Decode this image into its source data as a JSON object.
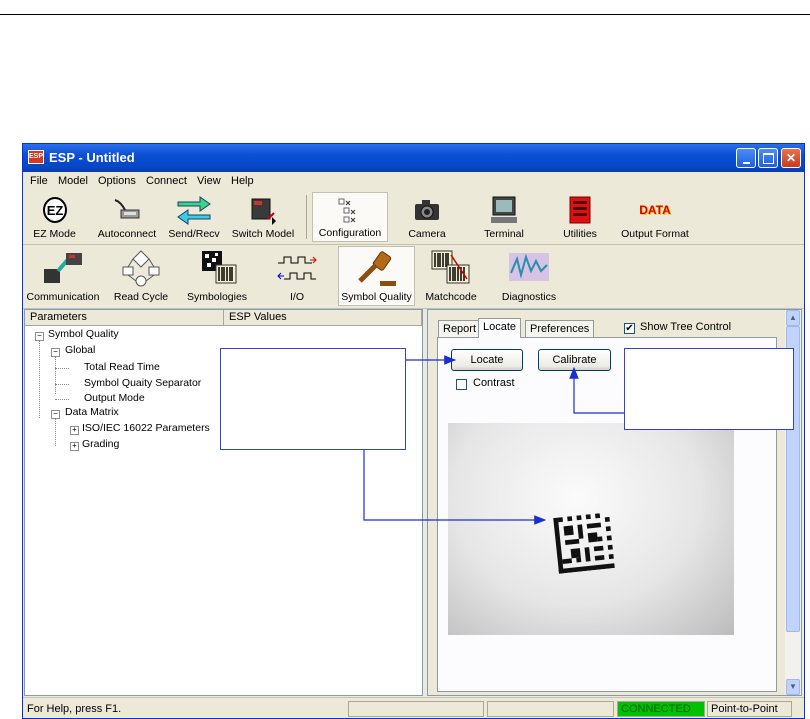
{
  "window": {
    "title": "ESP - Untitled",
    "app_icon_text": "ESP"
  },
  "menu": [
    "File",
    "Model",
    "Options",
    "Connect",
    "View",
    "Help"
  ],
  "toolbar1": [
    {
      "label": "EZ Mode",
      "icon": "ez-mode-icon"
    },
    {
      "label": "Autoconnect",
      "icon": "cable-icon"
    },
    {
      "label": "Send/Recv",
      "icon": "send-recv-icon"
    },
    {
      "label": "Switch Model",
      "icon": "switch-model-icon"
    },
    {
      "label": "Configuration",
      "icon": "configuration-icon",
      "selected": true
    },
    {
      "label": "Camera",
      "icon": "camera-icon"
    },
    {
      "label": "Terminal",
      "icon": "terminal-icon"
    },
    {
      "label": "Utilities",
      "icon": "utilities-icon"
    },
    {
      "label": "Output Format",
      "icon": "data-icon",
      "icon_text": "DATA"
    }
  ],
  "toolbar2": [
    {
      "label": "Communication",
      "icon": "communication-icon"
    },
    {
      "label": "Read Cycle",
      "icon": "read-cycle-icon"
    },
    {
      "label": "Symbologies",
      "icon": "symbologies-icon"
    },
    {
      "label": "I/O",
      "icon": "io-icon"
    },
    {
      "label": "Symbol Quality",
      "icon": "gavel-icon",
      "selected": true
    },
    {
      "label": "Matchcode",
      "icon": "matchcode-icon"
    },
    {
      "label": "Diagnostics",
      "icon": "diagnostics-icon"
    }
  ],
  "tree": {
    "columns": [
      "Parameters",
      "ESP Values"
    ],
    "items": [
      "Symbol Quality",
      "Global",
      "Total Read Time",
      "Symbol Quaity Separator",
      "Output Mode",
      "Data Matrix",
      "ISO/IEC 16022 Parameters",
      "Grading"
    ]
  },
  "right": {
    "tabs": [
      "Report",
      "Locate",
      "Preferences"
    ],
    "active_tab": "Locate",
    "show_tree_control_label": "Show Tree Control",
    "show_tree_control_checked": true,
    "locate_button": "Locate",
    "calibrate_button": "Calibrate",
    "contrast_label": "Contrast",
    "contrast_checked": false
  },
  "status": {
    "help": "For Help, press F1.",
    "connection": "CONNECTED",
    "mode": "Point-to-Point",
    "connected_color": "#00c000"
  },
  "colors": {
    "title_bar": "#0a4fd4",
    "annotation": "#1a2fd0"
  }
}
